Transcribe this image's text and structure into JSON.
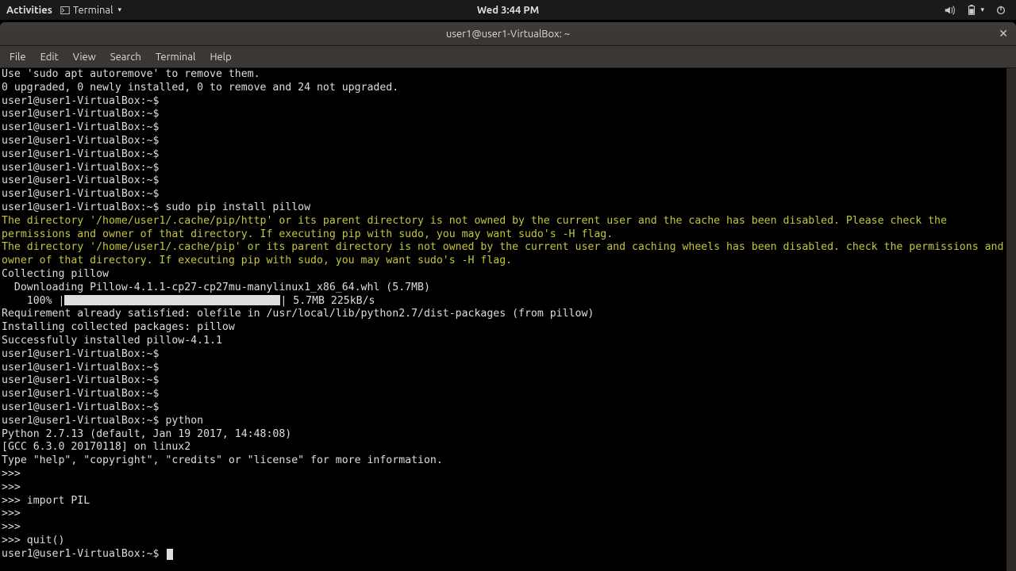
{
  "top_panel": {
    "activities": "Activities",
    "app": "Terminal",
    "clock": "Wed  3:44 PM"
  },
  "window": {
    "title": "user1@user1-VirtualBox: ~"
  },
  "menu": {
    "file": "File",
    "edit": "Edit",
    "view": "View",
    "search": "Search",
    "terminal": "Terminal",
    "help": "Help"
  },
  "term": {
    "autoremove": "Use 'sudo apt autoremove' to remove them.",
    "upgraded": "0 upgraded, 0 newly installed, 0 to remove and 24 not upgraded.",
    "prompt": "user1@user1-VirtualBox:~$ ",
    "cmd_pip": "sudo pip install pillow",
    "warn1": "The directory '/home/user1/.cache/pip/http' or its parent directory is not owned by the current user and the cache has been disabled. Please check the permissions and owner of that directory. If executing pip with sudo, you may want sudo's -H flag.",
    "warn2": "The directory '/home/user1/.cache/pip' or its parent directory is not owned by the current user and caching wheels has been disabled. check the permissions and owner of that directory. If executing pip with sudo, you may want sudo's -H flag.",
    "collecting": "Collecting pillow",
    "downloading": "  Downloading Pillow-4.1.1-cp27-cp27mu-manylinux1_x86_64.whl (5.7MB)",
    "prog_pct": "    100% |",
    "prog_rest": "| 5.7MB 225kB/s",
    "req": "Requirement already satisfied: olefile in /usr/local/lib/python2.7/dist-packages (from pillow)",
    "installing": "Installing collected packages: pillow",
    "success": "Successfully installed pillow-4.1.1",
    "cmd_python": "python",
    "py_ver": "Python 2.7.13 (default, Jan 19 2017, 14:48:08) ",
    "py_gcc": "[GCC 6.3.0 20170118] on linux2",
    "py_help": "Type \"help\", \"copyright\", \"credits\" or \"license\" for more information.",
    "py_prompt": ">>> ",
    "py_import": "import PIL",
    "py_quit": "quit()"
  }
}
